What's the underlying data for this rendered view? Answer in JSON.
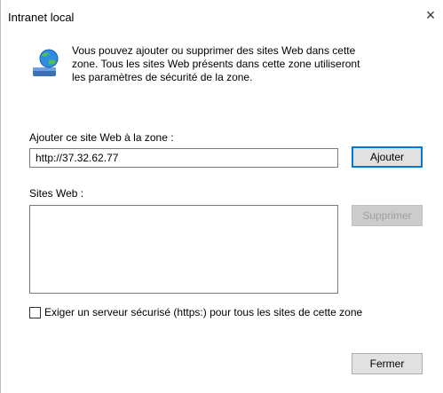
{
  "dialog": {
    "title": "Intranet local",
    "close_label": "×"
  },
  "info": {
    "icon": "intranet-globe-icon",
    "lines": [
      "Vous pouvez ajouter ou supprimer des sites Web dans cette",
      "zone. Tous les sites Web présents dans cette zone utiliseront",
      "les paramètres de sécurité de la zone."
    ]
  },
  "add_site": {
    "label": "Ajouter ce site Web à la zone :",
    "value": "http://37.32.62.77",
    "button_label": "Ajouter"
  },
  "sites": {
    "label": "Sites Web :",
    "items": [],
    "remove_label": "Supprimer"
  },
  "https_option": {
    "label": "Exiger un serveur sécurisé (https:) pour tous les sites de cette zone",
    "checked": false
  },
  "footer": {
    "close_button_label": "Fermer"
  }
}
